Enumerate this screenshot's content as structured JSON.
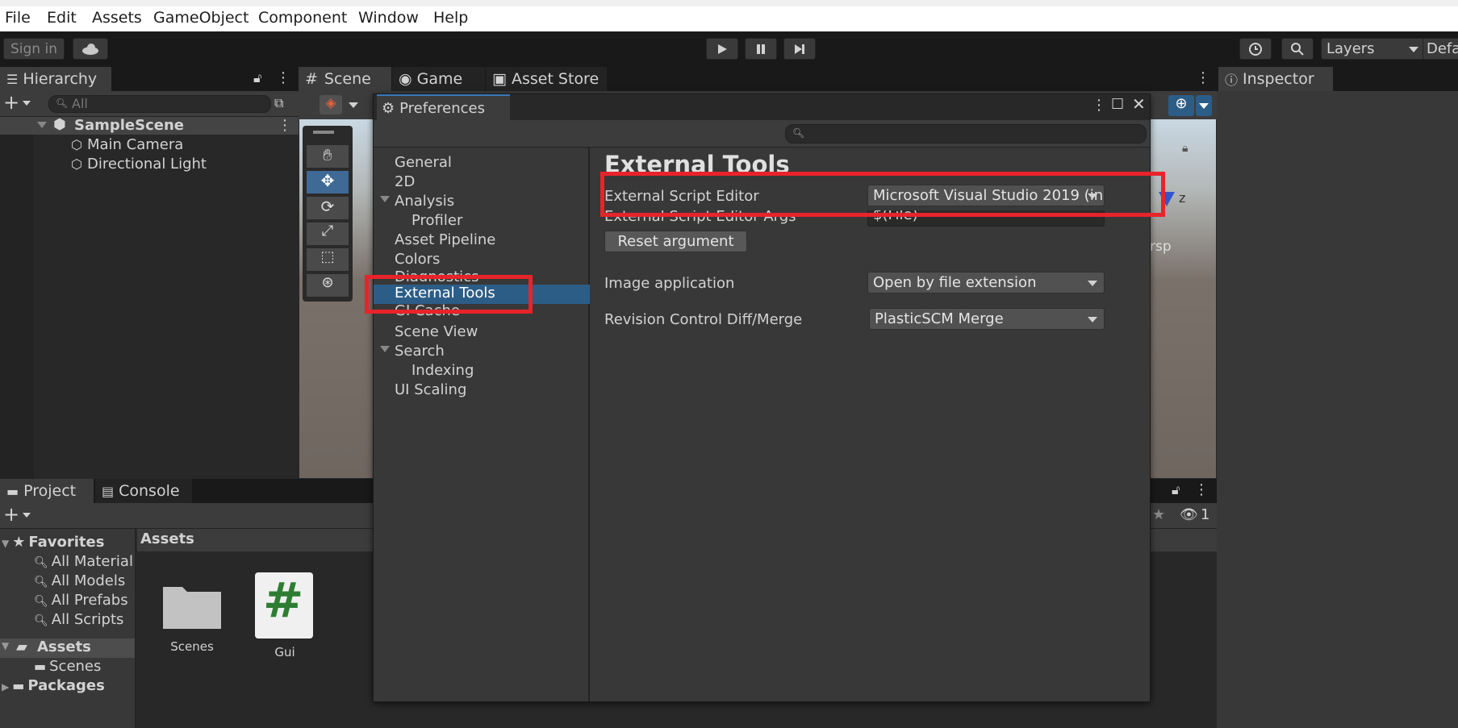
{
  "menu": [
    "File",
    "Edit",
    "Assets",
    "GameObject",
    "Component",
    "Window",
    "Help"
  ],
  "toolbar": {
    "sign_in": "Sign in",
    "layers": "Layers",
    "layout": "Defa"
  },
  "hierarchy": {
    "tab": "Hierarchy",
    "search_placeholder": "All",
    "scene": "SampleScene",
    "items": [
      "Main Camera",
      "Directional Light"
    ]
  },
  "scene_tabs": [
    "Scene",
    "Game",
    "Asset Store"
  ],
  "scene_overlay": {
    "persp": "rsp",
    "axis_z": "z"
  },
  "inspector": {
    "tab": "Inspector"
  },
  "preferences": {
    "title": "Preferences",
    "search_placeholder": "",
    "nav": [
      {
        "label": "General",
        "indent": false
      },
      {
        "label": "2D",
        "indent": false
      },
      {
        "label": "Analysis",
        "indent": false,
        "expanded": true
      },
      {
        "label": "Profiler",
        "indent": true
      },
      {
        "label": "Asset Pipeline",
        "indent": false
      },
      {
        "label": "Colors",
        "indent": false
      },
      {
        "label": "Diagnostics",
        "indent": false
      },
      {
        "label": "External Tools",
        "indent": false,
        "selected": true
      },
      {
        "label": "GI Cache",
        "indent": false
      },
      {
        "label": "Scene View",
        "indent": false
      },
      {
        "label": "Search",
        "indent": false,
        "expanded": true
      },
      {
        "label": "Indexing",
        "indent": true
      },
      {
        "label": "UI Scaling",
        "indent": false
      }
    ],
    "section_title": "External Tools",
    "fields": {
      "script_editor_label": "External Script Editor",
      "script_editor_value": "Microsoft Visual Studio 2019 (in",
      "script_args_label": "External Script Editor Args",
      "script_args_value": "$(File)",
      "reset_button": "Reset argument",
      "image_app_label": "Image application",
      "image_app_value": "Open by file extension",
      "diff_label": "Revision Control Diff/Merge",
      "diff_value": "PlasticSCM Merge"
    }
  },
  "project": {
    "tabs": [
      "Project",
      "Console"
    ],
    "favorites_label": "Favorites",
    "favorites": [
      "All Material",
      "All Models",
      "All Prefabs",
      "All Scripts"
    ],
    "assets_label": "Assets",
    "asset_children": [
      "Scenes"
    ],
    "packages_label": "Packages",
    "breadcrumb": "Assets",
    "files": [
      {
        "name": "Scenes",
        "kind": "folder"
      },
      {
        "name": "Gui",
        "kind": "script"
      }
    ],
    "hidden_count": "1"
  },
  "colors": {
    "selection": "#2c5d87",
    "highlight": "#e8232a",
    "script_icon": "#2e7d32"
  }
}
